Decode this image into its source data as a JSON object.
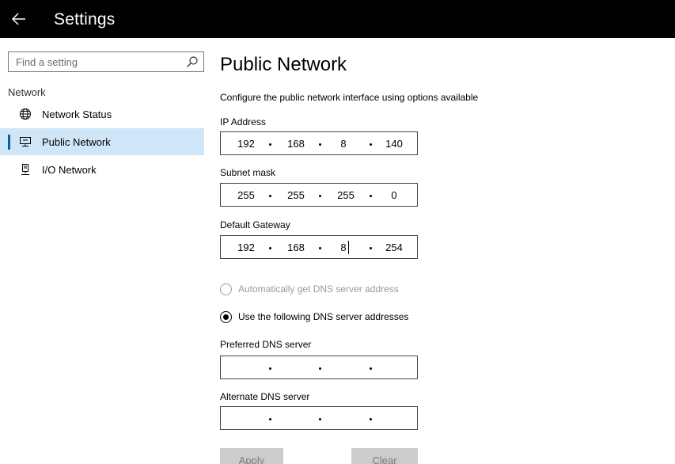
{
  "window": {
    "title": "Settings"
  },
  "search": {
    "placeholder": "Find a setting"
  },
  "sidebar": {
    "group_label": "Network",
    "items": [
      {
        "label": "Network Status",
        "icon": "globe-icon",
        "active": false
      },
      {
        "label": "Public Network",
        "icon": "monitor-network-icon",
        "active": true
      },
      {
        "label": "I/O Network",
        "icon": "io-network-icon",
        "active": false
      }
    ]
  },
  "main": {
    "title": "Public Network",
    "description": "Configure the public network interface using options available",
    "ip_address": {
      "label": "IP Address",
      "octets": [
        "192",
        "168",
        "8",
        "140"
      ]
    },
    "subnet_mask": {
      "label": "Subnet mask",
      "octets": [
        "255",
        "255",
        "255",
        "0"
      ]
    },
    "default_gateway": {
      "label": "Default Gateway",
      "octets": [
        "192",
        "168",
        "8",
        "254"
      ]
    },
    "dns_auto": {
      "label": "Automatically get DNS server address",
      "checked": false,
      "disabled": true
    },
    "dns_manual": {
      "label": "Use the following DNS server addresses",
      "checked": true
    },
    "preferred_dns": {
      "label": "Preferred DNS server",
      "octets": [
        "",
        "",
        "",
        ""
      ]
    },
    "alternate_dns": {
      "label": "Alternate DNS server",
      "octets": [
        "",
        "",
        "",
        ""
      ]
    },
    "apply_label": "Apply",
    "clear_label": "Clear"
  },
  "colors": {
    "accent": "#0063b1",
    "active_bg": "#cfe6f8",
    "titlebar": "#000000",
    "disabled_button": "#cccccc"
  }
}
